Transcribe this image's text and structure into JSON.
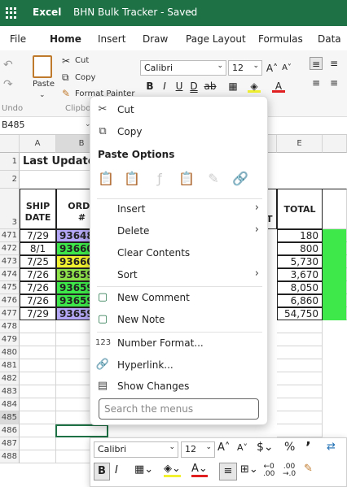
{
  "title_bar": {
    "app": "Excel",
    "document": "BHN Bulk Tracker - Saved"
  },
  "ribbon_tabs": [
    "File",
    "Home",
    "Insert",
    "Draw",
    "Page Layout",
    "Formulas",
    "Data"
  ],
  "active_tab": "Home",
  "ribbon": {
    "paste_label": "Paste",
    "cut_label": "Cut",
    "copy_label": "Copy",
    "format_painter_label": "Format Painter",
    "clipboard_group": "Clipboa",
    "undo_group": "Undo",
    "font_name": "Calibri",
    "font_size": "12"
  },
  "formula_bar": {
    "name_box": "B485"
  },
  "columns": [
    "A",
    "B",
    "E"
  ],
  "title_cell": "Last Updated",
  "headers": {
    "ship_date": "SHIP DATE",
    "order": "ORDE #",
    "total": "TOTAL",
    "d_partial": "T"
  },
  "rows": [
    {
      "num": "471",
      "date": "7/29",
      "order": "93648",
      "total": "180"
    },
    {
      "num": "472",
      "date": "8/1",
      "order": "93660",
      "total": "800"
    },
    {
      "num": "473",
      "date": "7/25",
      "order": "93660",
      "total": "5,730"
    },
    {
      "num": "474",
      "date": "7/26",
      "order": "93659",
      "total": "3,670"
    },
    {
      "num": "475",
      "date": "7/26",
      "order": "93659",
      "total": "8,050"
    },
    {
      "num": "476",
      "date": "7/26",
      "order": "93659",
      "total": "6,860"
    },
    {
      "num": "477",
      "date": "7/29",
      "order": "93659",
      "total": "54,750"
    }
  ],
  "empty_rows": [
    "478",
    "479",
    "480",
    "481",
    "482",
    "483",
    "484",
    "485",
    "486",
    "487",
    "488"
  ],
  "top_rows": [
    "1",
    "2",
    "3"
  ],
  "context_menu": {
    "cut": "Cut",
    "copy": "Copy",
    "paste_options": "Paste Options",
    "insert": "Insert",
    "delete": "Delete",
    "clear_contents": "Clear Contents",
    "sort": "Sort",
    "new_comment": "New Comment",
    "new_note": "New Note",
    "number_format": "Number Format...",
    "hyperlink": "Hyperlink...",
    "show_changes": "Show Changes",
    "search_placeholder": "Search the menus"
  },
  "mini_toolbar": {
    "font_name": "Calibri",
    "font_size": "12"
  },
  "colors": {
    "brand": "#1e7145",
    "purple": "#b4a7f5",
    "green": "#3ee84a",
    "yellow": "#f2f230",
    "lime": "#8ee24a"
  }
}
